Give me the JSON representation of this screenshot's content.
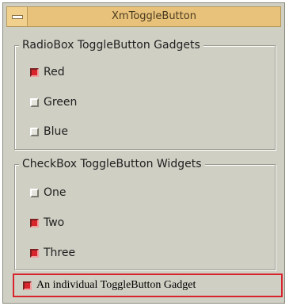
{
  "window": {
    "title": "XmToggleButton"
  },
  "radio_box": {
    "title": "RadioBox ToggleButton Gadgets",
    "items": [
      {
        "label": "Red",
        "selected": true
      },
      {
        "label": "Green",
        "selected": false
      },
      {
        "label": "Blue",
        "selected": false
      }
    ]
  },
  "check_box": {
    "title": "CheckBox ToggleButton Widgets",
    "items": [
      {
        "label": "One",
        "checked": false
      },
      {
        "label": "Two",
        "checked": true
      },
      {
        "label": "Three",
        "checked": true
      }
    ]
  },
  "individual_toggle": {
    "label": "An individual ToggleButton Gadget",
    "checked": true
  },
  "colors": {
    "title_bar": "#e8c27a",
    "background": "#cfcfc4",
    "indicator_on": "#d8242c",
    "focus_highlight": "#d8242c"
  },
  "icons": {
    "window_menu": "window-menu-icon"
  }
}
